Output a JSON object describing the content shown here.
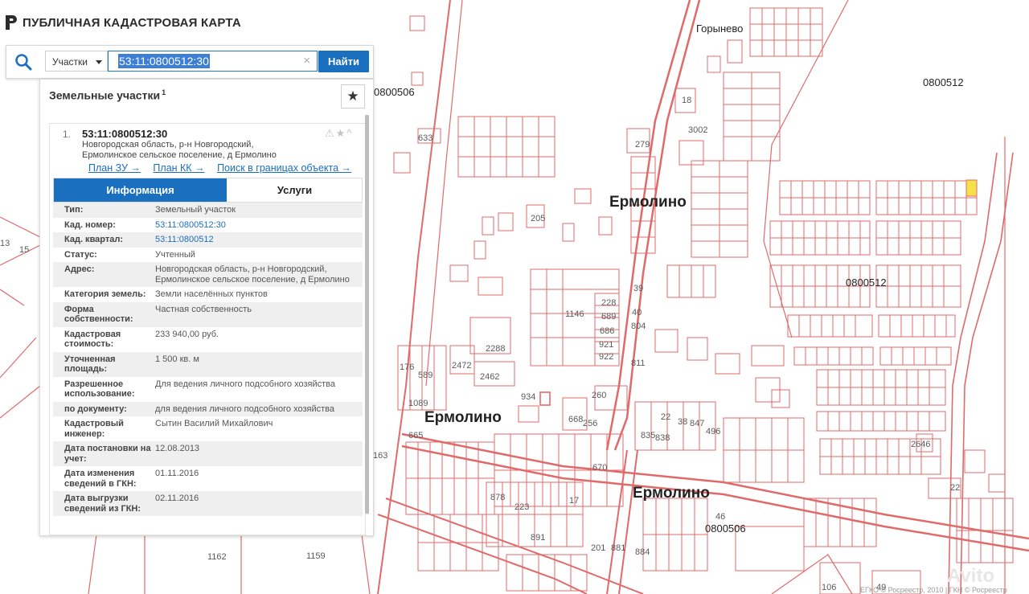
{
  "app": {
    "title": "ПУБЛИЧНАЯ КАДАСТРОВАЯ КАРТА"
  },
  "search": {
    "type_label": "Участки",
    "query": "53:11:0800512:30",
    "clear_symbol": "×",
    "find_label": "Найти"
  },
  "panel": {
    "title": "Земельные участки",
    "count": "1",
    "favorite_symbol": "★"
  },
  "result": {
    "number": "1.",
    "cad_number": "53:11:0800512:30",
    "address_lines": [
      "Новгородская область, р-н Новгородский,",
      "Ермолинское сельское поселение, д Ермолино"
    ],
    "status_icons": "⚠★^",
    "links": [
      "План ЗУ →",
      "План КК →",
      "Поиск в границах объекта →"
    ]
  },
  "tabs": {
    "info": "Информация",
    "services": "Услуги"
  },
  "attributes": [
    {
      "key": "Тип:",
      "value": "Земельный участок"
    },
    {
      "key": "Кад. номер:",
      "value": "53:11:0800512:30",
      "link": true
    },
    {
      "key": "Кад. квартал:",
      "value": "53:11:0800512",
      "link": true
    },
    {
      "key": "Статус:",
      "value": "Учтенный"
    },
    {
      "key": "Адрес:",
      "value": "Новгородская область, р-н Новгородский, Ермолинское сельское поселение, д Ермолино"
    },
    {
      "key": "Категория земель:",
      "value": "Земли населённых пунктов"
    },
    {
      "key": "Форма собственности:",
      "value": "Частная собственность"
    },
    {
      "key": "Кадастровая стоимость:",
      "value": "233 940,00 руб."
    },
    {
      "key": "Уточненная площадь:",
      "value": "1 500 кв. м"
    },
    {
      "key": "Разрешенное использование:",
      "value": "Для ведения личного подсобного хозяйства"
    },
    {
      "key": "по документу:",
      "value": "для ведения личного подсобного хозяйства"
    },
    {
      "key": "Кадастровый инженер:",
      "value": "Сытин Василий Михайлович"
    },
    {
      "key": "Дата постановки на учет:",
      "value": "12.08.2013"
    },
    {
      "key": "Дата изменения сведений в ГКН:",
      "value": "01.11.2016"
    },
    {
      "key": "Дата выгрузки сведений из ГКН:",
      "value": "02.11.2016"
    }
  ],
  "map": {
    "settlement_labels": [
      "Ермолино",
      "Ермолино",
      "Ермолино"
    ],
    "village_label": "Горынево",
    "quarter_labels": [
      "0800512",
      "0800512",
      "0800506",
      "0800506"
    ],
    "parcel_labels": [
      "633",
      "18",
      "3002",
      "279",
      "205",
      "39",
      "40",
      "228",
      "689",
      "686",
      "804",
      "921",
      "922",
      "811",
      "1146",
      "2288",
      "2472",
      "2462",
      "176",
      "589",
      "1089",
      "665",
      "260",
      "934",
      "668",
      "256",
      "835",
      "838",
      "22",
      "38",
      "847",
      "496",
      "201",
      "881",
      "884",
      "2646",
      "1162",
      "1159",
      "106",
      "49",
      "163",
      "46",
      "13",
      "15",
      "22",
      "891",
      "878",
      "223",
      "17",
      "670"
    ],
    "copyright": "ЕГКО © Росреестр, 2010 | ГКН © Росреестр",
    "watermark": "Avito",
    "parcel_color": "#e06a6a",
    "highlight_color": "#f5e24a"
  }
}
